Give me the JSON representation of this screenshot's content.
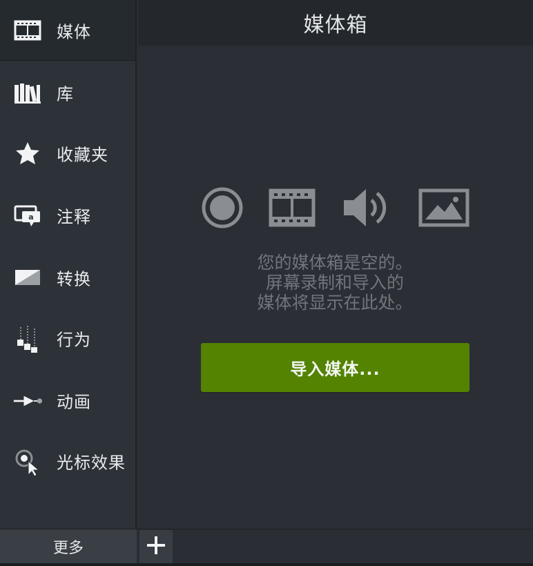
{
  "sidebar": {
    "items": [
      {
        "label": "媒体",
        "icon": "film-strip-icon",
        "active": true
      },
      {
        "label": "库",
        "icon": "library-books-icon"
      },
      {
        "label": "收藏夹",
        "icon": "star-icon"
      },
      {
        "label": "注释",
        "icon": "callout-icon"
      },
      {
        "label": "转换",
        "icon": "transition-icon"
      },
      {
        "label": "行为",
        "icon": "behavior-icon"
      },
      {
        "label": "动画",
        "icon": "animation-arrow-icon"
      },
      {
        "label": "光标效果",
        "icon": "cursor-effect-icon"
      }
    ],
    "more_label": "更多"
  },
  "main": {
    "title": "媒体箱",
    "media_types": [
      "recording-icon",
      "video-icon",
      "audio-icon",
      "image-icon"
    ],
    "empty_message": {
      "line1": "您的媒体箱是空的。",
      "line2": "屏幕录制和导入的",
      "line3": "媒体将显示在此处。"
    },
    "import_button_label": "导入媒体..."
  },
  "colors": {
    "accent_green": "#538301",
    "sidebar_bg": "#2d3238",
    "main_bg": "#2b2f35",
    "header_bg": "#24282d",
    "muted_text": "#70757b"
  }
}
